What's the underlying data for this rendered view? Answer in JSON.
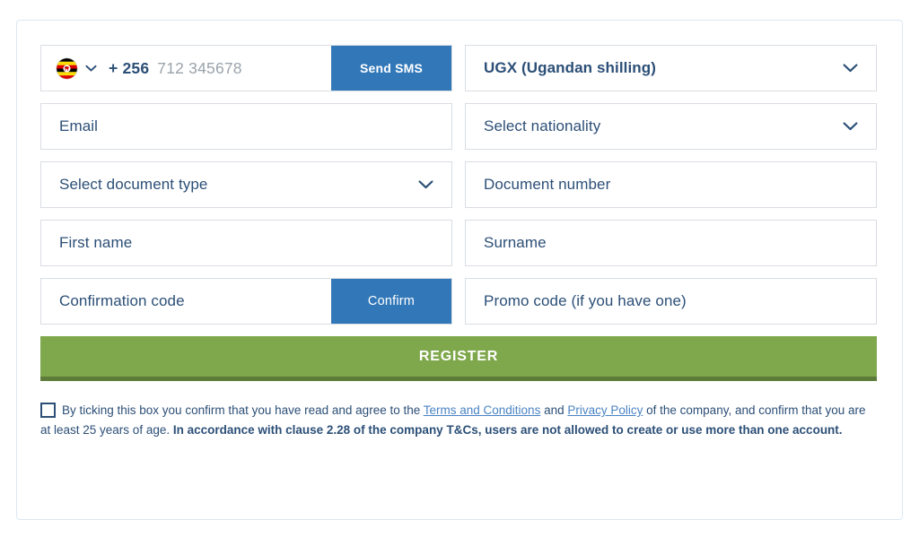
{
  "form": {
    "phone": {
      "flag_icon": "uganda-flag-icon",
      "caret_icon": "chevron-down-icon",
      "dial_code": "+ 256",
      "placeholder": "712 345678",
      "send_sms_label": "Send SMS"
    },
    "currency": {
      "value": "UGX (Ugandan shilling)",
      "chevron_icon": "chevron-down-icon"
    },
    "email": {
      "placeholder": "Email"
    },
    "nationality": {
      "value": "Select nationality",
      "chevron_icon": "chevron-down-icon"
    },
    "document_type": {
      "value": "Select document type",
      "chevron_icon": "chevron-down-icon"
    },
    "document_number": {
      "placeholder": "Document number"
    },
    "first_name": {
      "placeholder": "First name"
    },
    "surname": {
      "placeholder": "Surname"
    },
    "confirmation_code": {
      "placeholder": "Confirmation code",
      "confirm_label": "Confirm"
    },
    "promo_code": {
      "placeholder": "Promo code (if you have one)"
    },
    "register_label": "REGISTER"
  },
  "terms": {
    "part1": "By ticking this box you confirm that you have read and agree to the ",
    "link_terms": "Terms and Conditions",
    "part2": " and ",
    "link_privacy": "Privacy Policy",
    "part3": " of the company, and confirm that you are at least 25 years of age. ",
    "bold_part": "In accordance with clause 2.28 of the company T&Cs, users are not allowed to create or use more than one account.",
    "checked": false
  },
  "colors": {
    "accent_blue": "#3278b9",
    "text_blue": "#2c4f77",
    "link_blue": "#4a83c4",
    "register_green": "#7fa74c",
    "register_green_dark": "#5d7b39",
    "field_border": "#d9dde2",
    "card_border": "#dce7f2",
    "placeholder_gray": "#9aa3ab"
  }
}
